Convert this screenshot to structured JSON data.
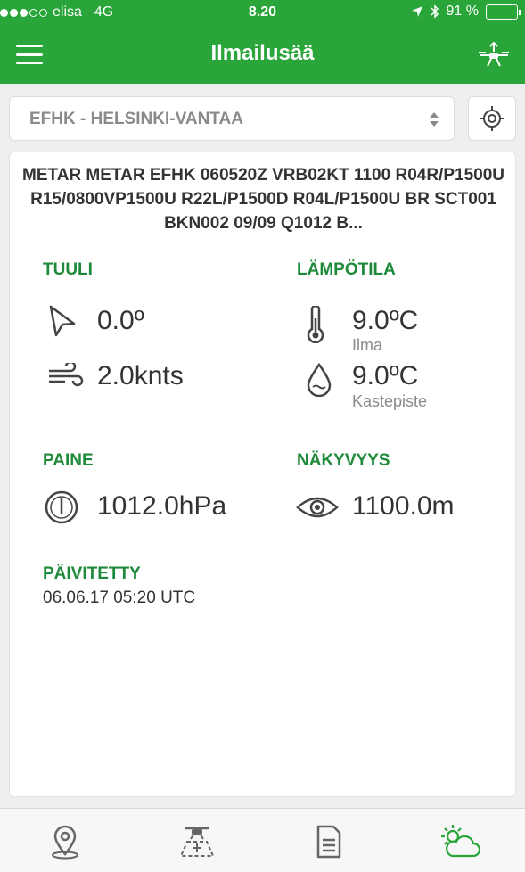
{
  "status_bar": {
    "signal": "●●●○○",
    "carrier": "elisa",
    "network": "4G",
    "time": "8.20",
    "battery": "91 %",
    "battery_level": 0.91
  },
  "header": {
    "title": "Ilmailusää"
  },
  "station": {
    "selected": "EFHK - HELSINKI-VANTAA"
  },
  "metar": {
    "text": "METAR METAR EFHK 060520Z VRB02KT 1100 R04R/P1500U R15/0800VP1500U R22L/P1500D R04L/P1500U BR SCT001 BKN002 09/09 Q1012 B..."
  },
  "wind": {
    "label": "TUULI",
    "direction": "0.0º",
    "speed": "2.0knts"
  },
  "temperature": {
    "label": "LÄMPÖTILA",
    "air_value": "9.0ºC",
    "air_label": "Ilma",
    "dew_value": "9.0ºC",
    "dew_label": "Kastepiste"
  },
  "pressure": {
    "label": "PAINE",
    "value": "1012.0hPa"
  },
  "visibility": {
    "label": "NÄKYVYYS",
    "value": "1100.0m"
  },
  "updated": {
    "label": "PÄIVITETTY",
    "value": "06.06.17 05:20 UTC"
  },
  "tabs": [
    {
      "icon": "map-pin-icon",
      "active": false
    },
    {
      "icon": "drone-area-icon",
      "active": false
    },
    {
      "icon": "document-icon",
      "active": false
    },
    {
      "icon": "weather-icon",
      "active": true
    }
  ],
  "colors": {
    "brand_green": "#2aa53a",
    "label_green": "#1e8a3a"
  }
}
